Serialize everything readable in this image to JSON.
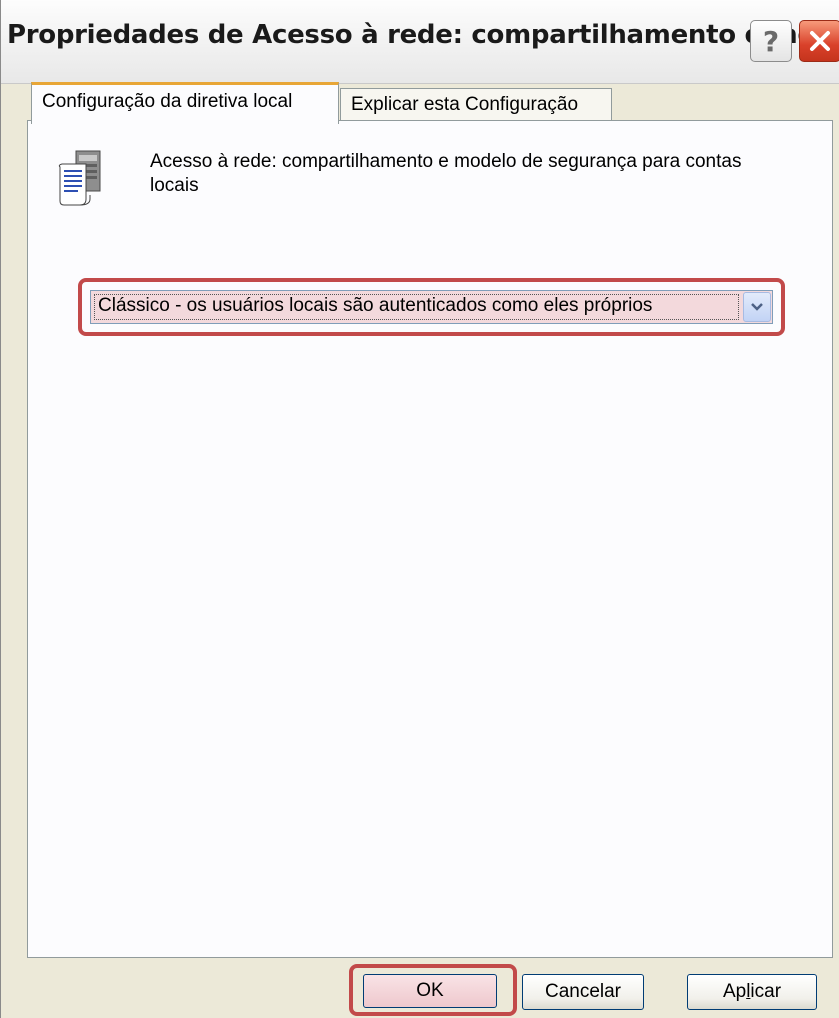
{
  "window": {
    "title": "Propriedades de Acesso à rede: compartilhamento e mo...",
    "help_label": "?"
  },
  "tabs": [
    {
      "label": "Configuração da diretiva local",
      "active": true
    },
    {
      "label": "Explicar esta Configuração",
      "active": false
    }
  ],
  "policy": {
    "icon": "policy-document-icon",
    "name": "Acesso à rede: compartilhamento e modelo de segurança para contas locais"
  },
  "dropdown": {
    "selected": "Clássico - os usuários locais são autenticados como eles próprios",
    "icon": "chevron-down-icon",
    "highlight_color": "#c24a4a"
  },
  "buttons": {
    "ok": "OK",
    "cancel": "Cancelar",
    "apply_pre": "Ap",
    "apply_accel": "l",
    "apply_post": "icar"
  },
  "colors": {
    "dialog_bg": "#ece9d8",
    "panel_bg": "#fcfcfe",
    "highlight": "#c24a4a",
    "close_button": "#d9412a"
  }
}
